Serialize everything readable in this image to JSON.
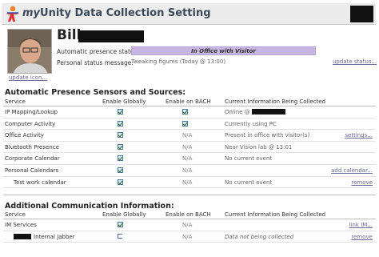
{
  "header": {
    "app_title_prefix": "my",
    "app_title_main": "Unity Data Collection Setting"
  },
  "profile": {
    "name": "Bill",
    "presence_label": "Automatic presence state:",
    "presence_value": "In Office with Visitor",
    "status_label": "Personal status message:",
    "status_value": "Tweaking figures (Today @ 13:00)",
    "update_status": "update status...",
    "update_icon": "update icon..."
  },
  "sensors": {
    "title": "Automatic Presence Sensors and Sources:",
    "columns": [
      "Service",
      "Enable Globally",
      "Enable on BACH",
      "Current Information Being Collected"
    ],
    "na": "N/A",
    "rows": [
      {
        "service": "IP Mapping/Lookup",
        "info": "Online @",
        "action": ""
      },
      {
        "service": "Computer Activity",
        "info": "Currently using PC",
        "action": ""
      },
      {
        "service": "Office Activity",
        "info": "Present in office with visitor(s)",
        "action": "settings..."
      },
      {
        "service": "Bluetooth Presence",
        "info": "Near Vision lab @ 13:01",
        "action": ""
      },
      {
        "service": "Corporate Calendar",
        "info": "No current event",
        "action": ""
      },
      {
        "service": "Personal Calendars",
        "info": "",
        "action": "add calendar..."
      },
      {
        "service": "Test work calendar",
        "info": "No current event",
        "action": "remove"
      }
    ]
  },
  "comms": {
    "title": "Additional Communication Information:",
    "columns": [
      "Service",
      "Enable Globally",
      "Enable on BACH",
      "Current Information Being Collected"
    ],
    "rows": [
      {
        "service": "IM Services",
        "info": "",
        "action": "link IM..."
      },
      {
        "service": "Internal Jabber",
        "info": "Data not being collected",
        "action": "remove"
      }
    ]
  }
}
